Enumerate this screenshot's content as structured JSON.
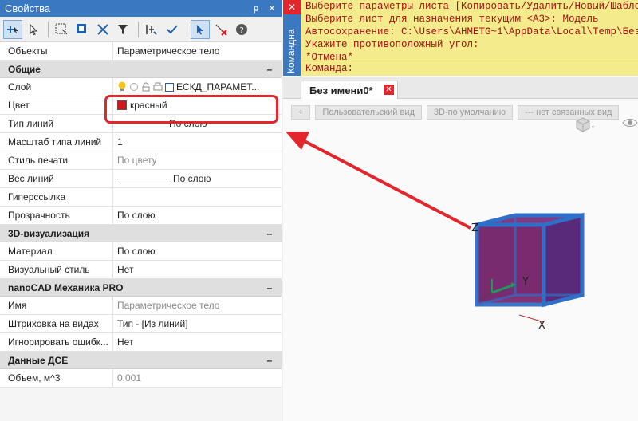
{
  "panel": {
    "title": "Свойства",
    "pin_glyph": "ᵽ",
    "close_glyph": "✕"
  },
  "grid": {
    "objects_label": "Объекты",
    "objects_value": "Параметрическое тело",
    "sections": {
      "general": "Общие",
      "viz3d": "3D-визуализация",
      "nanocad": "nanoCAD Механика PRO",
      "dse": "Данные ДСЕ"
    },
    "rows": {
      "layer": {
        "k": "Слой",
        "v": "ЕСКД_ПАРАМЕТ..."
      },
      "color": {
        "k": "Цвет",
        "v": "красный"
      },
      "linetype": {
        "k": "Тип линий",
        "v": "По слою"
      },
      "ltscale": {
        "k": "Масштаб типа линий",
        "v": "1"
      },
      "plotstyle": {
        "k": "Стиль печати",
        "v": "По цвету"
      },
      "lineweight": {
        "k": "Вес линий",
        "v": "По слою"
      },
      "hyperlink": {
        "k": "Гиперссылка",
        "v": ""
      },
      "transparency": {
        "k": "Прозрачность",
        "v": "По слою"
      },
      "material": {
        "k": "Материал",
        "v": "По слою"
      },
      "visualstyle": {
        "k": "Визуальный стиль",
        "v": "Нет"
      },
      "name": {
        "k": "Имя",
        "v": "Параметрическое тело"
      },
      "hatch": {
        "k": "Штриховка на видах",
        "v": "Тип - [Из линий]"
      },
      "ignore": {
        "k": "Игнорировать ошибк...",
        "v": "Нет"
      },
      "volume": {
        "k": "Объем, м^3",
        "v": "0.001"
      }
    }
  },
  "command": {
    "strip_label": "Командна",
    "lines": [
      "Выберите параметры листа [Копировать/Удалить/Новый/Шабло",
      "Выберите лист для назначения текущим <A3>: Модель",
      "Автосохранение: C:\\Users\\AHMETG~1\\AppData\\Local\\Temp\\Без",
      "Укажите противоположный угол:",
      "*Отмена*"
    ],
    "prompt": "Команда:"
  },
  "doc_tab": {
    "label": "Без имени0*"
  },
  "view_buttons": [
    "+",
    "Пользовательский вид",
    "3D-по умолчанию",
    "--- нет связанных вид"
  ],
  "axes": {
    "x": "X",
    "y": "Y",
    "z": "Z"
  },
  "colors": {
    "accent": "#3b78c2",
    "highlight": "#e2262b",
    "swatch_red": "#d7121a",
    "cmd_bg": "#f4eb8c",
    "cube_fill": "#7a2a7a",
    "cube_edge": "#2f6fc8"
  }
}
